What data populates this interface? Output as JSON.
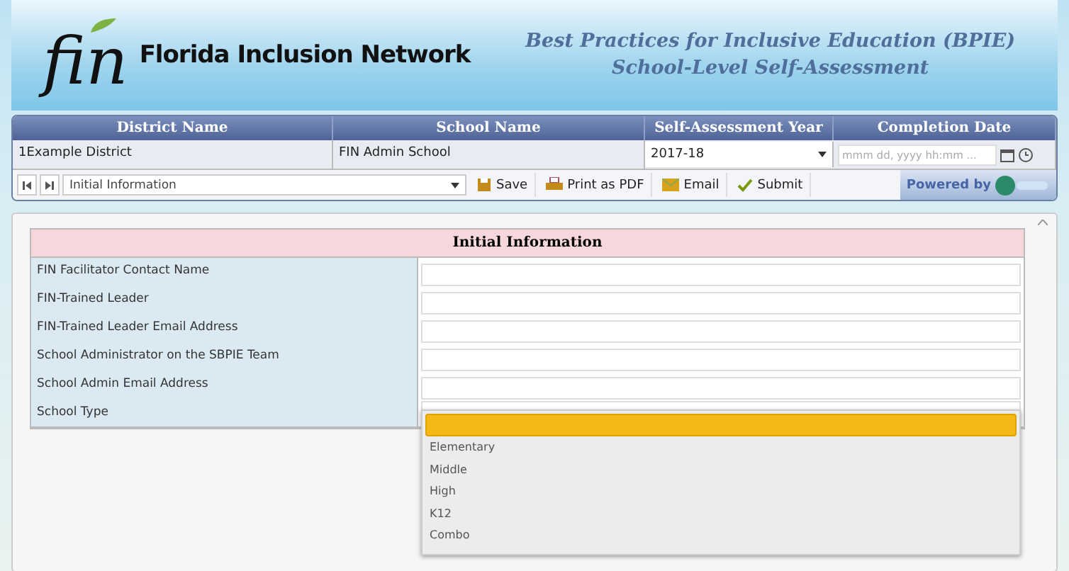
{
  "header": {
    "logo_text": "fin",
    "org_name": "Florida Inclusion Network",
    "title_line1": "Best Practices for Inclusive Education (BPIE)",
    "title_line2": "School-Level Self-Assessment"
  },
  "grid": {
    "columns": [
      "District Name",
      "School Name",
      "Self-Assessment Year",
      "Completion Date"
    ],
    "row": {
      "district": "1Example District",
      "school": "FIN Admin School",
      "year": "2017-18",
      "date_placeholder": "mmm dd, yyyy hh:mm ..."
    }
  },
  "toolbar": {
    "section": "Initial Information",
    "buttons": [
      {
        "label": "Save",
        "kind": "save"
      },
      {
        "label": "Print as PDF",
        "kind": "print"
      },
      {
        "label": "Email",
        "kind": "email"
      },
      {
        "label": "Submit",
        "kind": "submit"
      }
    ],
    "powered_by": "Powered by"
  },
  "form": {
    "title": "Initial Information",
    "fields": [
      {
        "label": "FIN Facilitator Contact Name",
        "kind": "text"
      },
      {
        "label": "FIN-Trained Leader",
        "kind": "text"
      },
      {
        "label": "FIN-Trained Leader Email Address",
        "kind": "text"
      },
      {
        "label": "School Administrator on the SBPIE Team",
        "kind": "text"
      },
      {
        "label": "School Admin Email Address",
        "kind": "text"
      },
      {
        "label": "School Type",
        "kind": "select"
      }
    ],
    "dropdown": {
      "blank_selected": true,
      "options": [
        {
          "label": "Elementary",
          "selected": false
        },
        {
          "label": "Middle",
          "selected": false
        },
        {
          "label": "High",
          "selected": false
        },
        {
          "label": "K12",
          "selected": false
        },
        {
          "label": "Combo",
          "selected": false
        }
      ]
    }
  }
}
